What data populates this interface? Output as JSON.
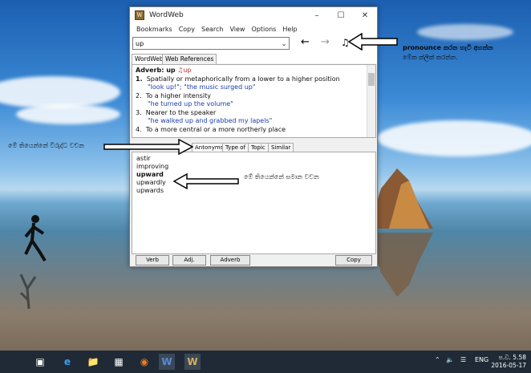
{
  "window": {
    "title": "WordWeb",
    "app_icon_text": "W"
  },
  "menu": [
    "Bookmarks",
    "Copy",
    "Search",
    "View",
    "Options",
    "Help"
  ],
  "search": {
    "value": "up"
  },
  "tabs_top": [
    "WordWeb",
    "Web References"
  ],
  "definition": {
    "pos_label": "Adverb: up",
    "sound_label": "up",
    "senses": [
      {
        "num": "1.",
        "text": "Spatially or metaphorically from a lower to a higher position",
        "example": "\"look up!\"; \"the music surged up\""
      },
      {
        "num": "2.",
        "text": "To a higher intensity",
        "example": "\"he turned up the volume\""
      },
      {
        "num": "3.",
        "text": "Nearer to the speaker",
        "example": "\"he walked up and grabbed my lapels\""
      },
      {
        "num": "4.",
        "text": "To a more central or a more northerly place",
        "example": ""
      }
    ]
  },
  "tabs_bottom": [
    "Antonyms",
    "Type of",
    "Topic",
    "Similar"
  ],
  "word_list": [
    "astir",
    "improving",
    "upward",
    "upwardly",
    "upwards"
  ],
  "bottom_buttons": {
    "verb": "Verb",
    "adj": "Adj.",
    "adverb": "Adverb",
    "copy": "Copy"
  },
  "annotations": {
    "pronounce": "pronounce කරන හැටි අහන්න",
    "pronounce_line2": "මේක ක්ලික් කරන්න.",
    "antonyms": "මේ තියෙන්නේ විරුද්ධ වචන",
    "synonyms": "මේ තියෙන්නේ සමාන වචන"
  },
  "taskbar": {
    "lang": "ENG",
    "time": "ප.ව. 5.58",
    "date": "2016-05-17"
  }
}
